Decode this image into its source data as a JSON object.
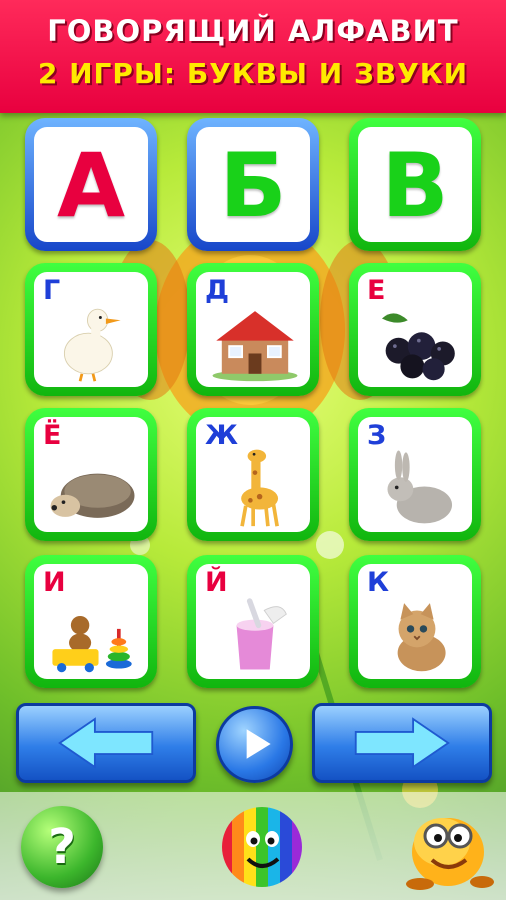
{
  "header": {
    "title": "ГОВОРЯЩИЙ АЛФАВИТ",
    "subtitle": "2 ИГРЫ: БУКВЫ И ЗВУКИ"
  },
  "colors": {
    "header_bg": "#e8003f",
    "title_color": "#ffffff",
    "subtitle_color": "#ffea00",
    "tile_green": "#22d41f",
    "tile_blue": "#2f6fe0",
    "letter_red": "#e8003f",
    "letter_green": "#19d119",
    "letter_blue": "#1f3fd8"
  },
  "tiles": [
    {
      "letter": "А",
      "color": "#e8003f",
      "frame": "blue",
      "image": null
    },
    {
      "letter": "Б",
      "color": "#19d119",
      "frame": "blue",
      "image": null
    },
    {
      "letter": "В",
      "color": "#19d119",
      "frame": "green",
      "image": null
    },
    {
      "letter": "Г",
      "color": "#1f3fd8",
      "frame": "green",
      "image": "duck-icon"
    },
    {
      "letter": "Д",
      "color": "#1f3fd8",
      "frame": "green",
      "image": "house-icon"
    },
    {
      "letter": "Е",
      "color": "#e8003f",
      "frame": "green",
      "image": "blackberry-icon"
    },
    {
      "letter": "Ё",
      "color": "#e8003f",
      "frame": "green",
      "image": "hedgehog-icon"
    },
    {
      "letter": "Ж",
      "color": "#1f3fd8",
      "frame": "green",
      "image": "giraffe-icon"
    },
    {
      "letter": "З",
      "color": "#1f3fd8",
      "frame": "green",
      "image": "rabbit-icon"
    },
    {
      "letter": "И",
      "color": "#e8003f",
      "frame": "green",
      "image": "toys-icon"
    },
    {
      "letter": "Й",
      "color": "#e8003f",
      "frame": "green",
      "image": "yogurt-icon"
    },
    {
      "letter": "К",
      "color": "#1f3fd8",
      "frame": "green",
      "image": "kitten-icon"
    }
  ],
  "controls": {
    "prev": "arrow-left-icon",
    "play": "play-icon",
    "next": "arrow-right-icon",
    "help_label": "?",
    "help": "help-icon",
    "games": "rainbow-ball-icon",
    "mascot": "smiley-mascot-icon"
  }
}
